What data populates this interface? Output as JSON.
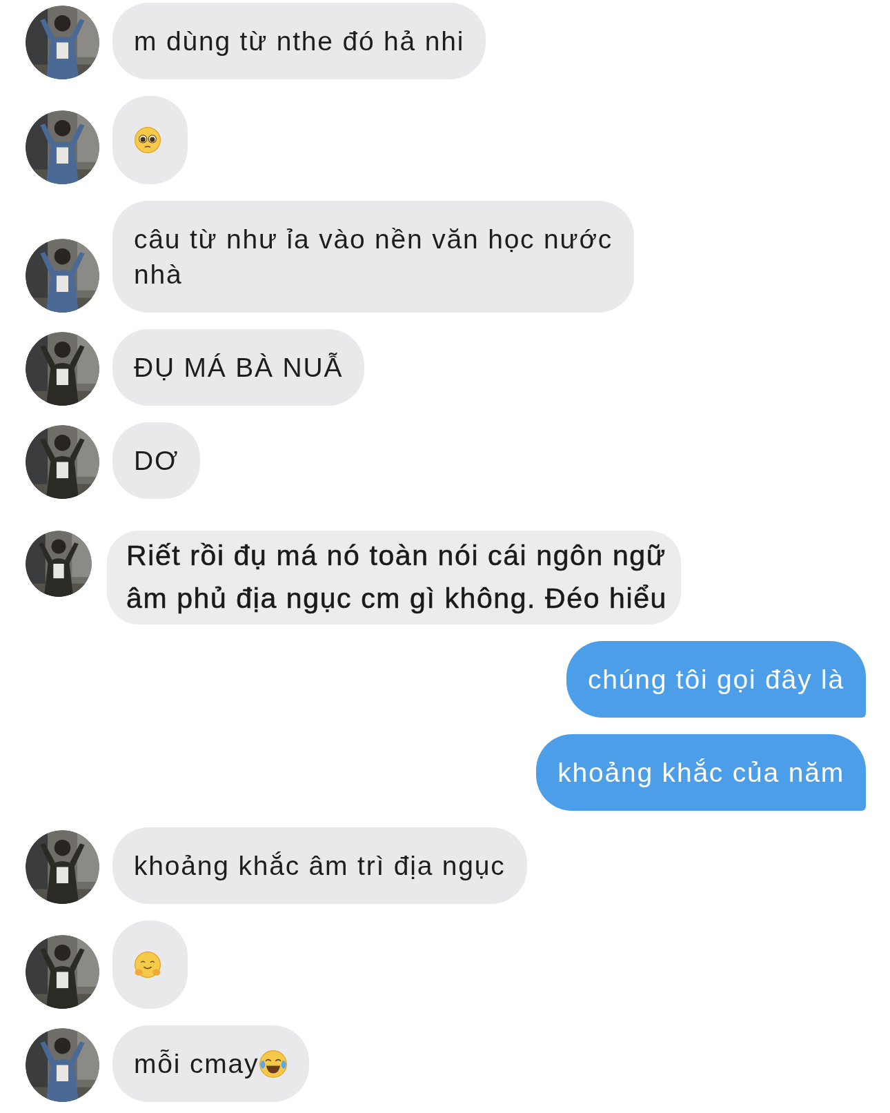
{
  "messages": [
    {
      "outgoing": false,
      "kind": "text",
      "text": "m dùng từ nthe đó hả nhi"
    },
    {
      "outgoing": false,
      "kind": "pleading"
    },
    {
      "outgoing": false,
      "kind": "text",
      "text": "câu từ như ỉa vào nền văn học nước\nnhà"
    },
    {
      "outgoing": false,
      "kind": "text",
      "text": "ĐỤ MÁ BÀ NUẪ"
    },
    {
      "outgoing": false,
      "kind": "text",
      "text": "DƠ"
    },
    {
      "outgoing": false,
      "kind": "snippet",
      "text": "Riết rồi đụ má nó toàn nói cái ngôn ngữ\nâm phủ địa ngục cm gì không. Đéo hiểu"
    },
    {
      "outgoing": true,
      "kind": "text",
      "text": "chúng tôi gọi đây là"
    },
    {
      "outgoing": true,
      "kind": "text",
      "text": "khoảng khắc của năm"
    },
    {
      "outgoing": false,
      "kind": "text",
      "text": "khoảng khắc âm trì địa ngục"
    },
    {
      "outgoing": false,
      "kind": "hug"
    },
    {
      "outgoing": false,
      "kind": "laughing",
      "text": "mỗi cmay"
    }
  ]
}
